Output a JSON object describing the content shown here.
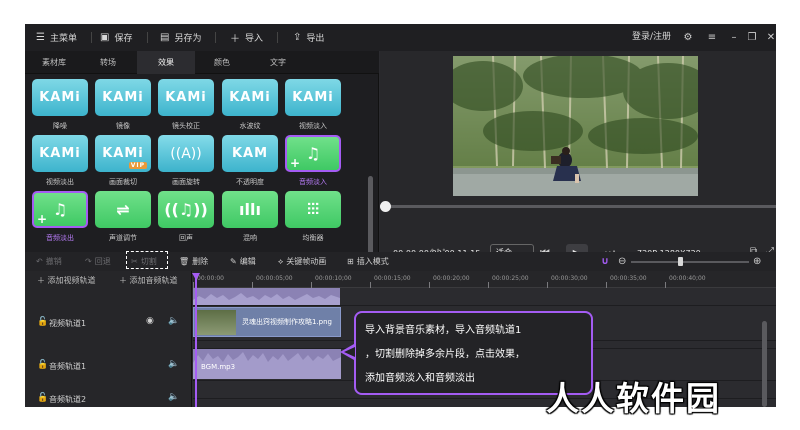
{
  "topbar": {
    "menu": "主菜单",
    "save": "保存",
    "save_as": "另存为",
    "import": "导入",
    "export": "导出",
    "login": "登录/注册"
  },
  "library": {
    "tabs": [
      "素材库",
      "转场",
      "效果",
      "颜色",
      "文字"
    ],
    "active_tab": "效果",
    "effects": [
      {
        "label": "降噪",
        "style": "kami",
        "thumb_text": "KAMi"
      },
      {
        "label": "镜像",
        "style": "kami",
        "thumb_text": "KAMi"
      },
      {
        "label": "镜头校正",
        "style": "kami",
        "thumb_text": "KAMi"
      },
      {
        "label": "水波纹",
        "style": "kami",
        "thumb_text": "KAMi"
      },
      {
        "label": "视频淡入",
        "style": "kami",
        "thumb_text": "KAMi"
      },
      {
        "label": "视频淡出",
        "style": "kami",
        "thumb_text": "KAMi"
      },
      {
        "label": "画面裁切",
        "style": "kami",
        "thumb_text": "KAMi",
        "badge": "VIP"
      },
      {
        "label": "画面旋转",
        "style": "teal",
        "thumb_text": "((A))"
      },
      {
        "label": "不透明度",
        "style": "kami",
        "thumb_text": "KAM"
      },
      {
        "label": "音频淡入",
        "style": "green",
        "thumb_text": "♫",
        "highlight": true
      },
      {
        "label": "音频淡出",
        "style": "green",
        "thumb_text": "♫",
        "highlight": true
      },
      {
        "label": "声道调节",
        "style": "green",
        "thumb_text": "⇌"
      },
      {
        "label": "回声",
        "style": "green",
        "thumb_text": "((♫))"
      },
      {
        "label": "混响",
        "style": "green",
        "thumb_text": "ıllı"
      },
      {
        "label": "均衡器",
        "style": "green",
        "thumb_text": "⫶⫶⫶"
      }
    ]
  },
  "preview": {
    "timecode": "00:00:00/00:00:11:15",
    "fit": "适合",
    "resolution": "720P 1280X720"
  },
  "edit_toolbar": {
    "undo": "撤销",
    "redo": "回退",
    "cut": "切割",
    "delete": "删除",
    "edit": "编辑",
    "keyframe": "关键帧动画",
    "insert_mode": "插入模式"
  },
  "timeline": {
    "add_video_track": "添加视频轨道",
    "add_audio_track": "添加音频轨道",
    "video_track_1": "视频轨道1",
    "audio_track_1": "音频轨道1",
    "audio_track_2": "音频轨道2",
    "ticks": [
      "00:00:00",
      "00:00:05;00",
      "00:00:10;00",
      "00:00:15;00",
      "00:00:20;00",
      "00:00:25;00",
      "00:00:30;00",
      "00:00:35;00",
      "00:00:40;00"
    ],
    "video_clip": "灵魂出窍视频制作攻略1.png",
    "audio_clip": "BGM.mp3"
  },
  "callout": {
    "line1": "导入背景音乐素材，导入音频轨道1",
    "line2": "，切割删除掉多余片段，点击效果，",
    "line3": "添加音频淡入和音频淡出"
  },
  "watermark": "人人软件园",
  "colors": {
    "accent": "#a45cf3",
    "background": "#2b2b2f",
    "kami_tile": "#3db4cd",
    "audio_tile": "#3fc964"
  }
}
